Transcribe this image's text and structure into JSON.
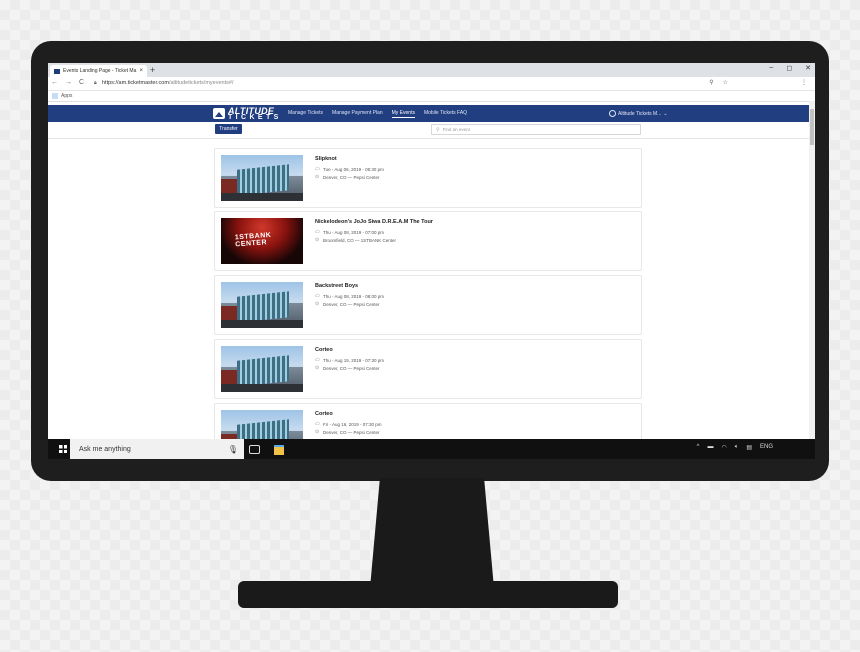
{
  "browser": {
    "tab_title": "Events Landing Page - Ticket Ma",
    "tab_close": "×",
    "new_tab": "+",
    "window_controls": [
      "–",
      "◻",
      "✕"
    ],
    "nav_icons": [
      "←",
      "→",
      "C"
    ],
    "url_host": "https://am.ticketmaster.com",
    "url_path": "/altitudetickets/myevents#/",
    "address_icons": [
      "search-icon",
      "star-icon",
      "menu-icon"
    ],
    "bookmarks_label": "Apps"
  },
  "site": {
    "logo_line1": "ALTITUDE",
    "logo_line2": "TICKETS",
    "nav": [
      "Manage Tickets",
      "Manage Payment Plan",
      "My Events",
      "Mobile Tickets FAQ"
    ],
    "active_nav": "My Events",
    "account_label": "Altitude Tickets M...",
    "transfer_label": "Transfer",
    "search_placeholder": "Find an event"
  },
  "events": [
    {
      "title": "Slipknot",
      "date": "Tue - Aug 06, 2019 - 05:30 pm",
      "venue": "Denver, CO — Pepsi Center",
      "image": "pepsi-center"
    },
    {
      "title": "Nickelodeon's JoJo Siwa D.R.E.A.M The Tour",
      "date": "Thu - Aug 08, 2019 - 07:00 pm",
      "venue": "Broomfield, CO — 1STBANK Center",
      "image": "1stbank-center"
    },
    {
      "title": "Backstreet Boys",
      "date": "Thu - Aug 08, 2019 - 08:00 pm",
      "venue": "Denver, CO — Pepsi Center",
      "image": "pepsi-center"
    },
    {
      "title": "Corteo",
      "date": "Thu - Aug 15, 2019 - 07:30 pm",
      "venue": "Denver, CO — Pepsi Center",
      "image": "pepsi-center"
    },
    {
      "title": "Corteo",
      "date": "Fri - Aug 16, 2019 - 07:30 pm",
      "venue": "Denver, CO — Pepsi Center",
      "image": "pepsi-center"
    }
  ],
  "taskbar": {
    "search_placeholder": "Ask me anything",
    "language": "ENG"
  },
  "colors": {
    "brand": "#213e80",
    "taskbar": "#101011"
  }
}
